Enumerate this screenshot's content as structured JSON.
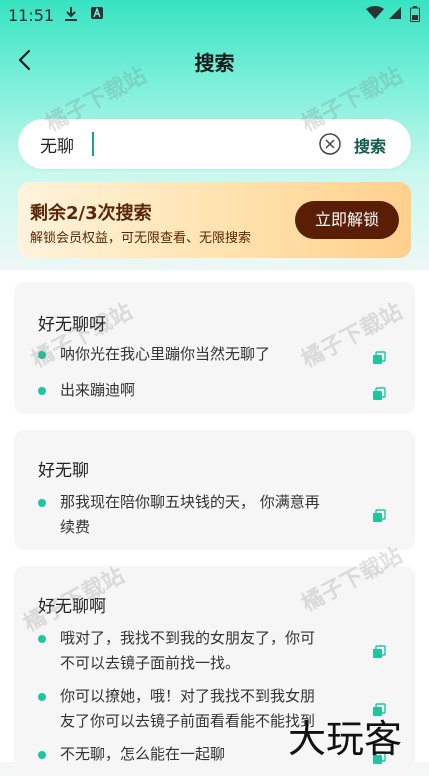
{
  "status_bar": {
    "time": "11:51",
    "download_icon": "download-icon",
    "app_icon": "app-badge-icon",
    "wifi_icon": "wifi-icon",
    "signal_icon": "signal-icon",
    "battery_icon": "battery-icon"
  },
  "nav": {
    "title": "搜索",
    "back_icon": "back-arrow-icon"
  },
  "search": {
    "value": "无聊",
    "button": "搜索",
    "clear_icon": "clear-circle-icon"
  },
  "banner": {
    "title": "剩余2/3次搜索",
    "subtitle": "解锁会员权益，可无限查看、无限搜索",
    "button": "立即解锁"
  },
  "results": [
    {
      "title": "好无聊呀",
      "lines": [
        "呐你光在我心里蹦你当然无聊了",
        "出来蹦迪啊"
      ]
    },
    {
      "title": "好无聊",
      "lines": [
        "那我现在陪你聊五块钱的天， 你满意再",
        "续费"
      ]
    },
    {
      "title": "好无聊啊",
      "lines": [
        "哦对了，我找不到我的女朋友了，你可",
        "不可以去镜子面前找一找。",
        "你可以撩她，哦！对了我找不到我女朋",
        "友了你可以去镜子前面看看能不能找到",
        "不无聊，怎么能在一起聊"
      ]
    }
  ],
  "watermarks": [
    "橘子下载站",
    "橘子下载站",
    "橘子下载站",
    "橘子下载站",
    "橘子下载站",
    "橘子下载站"
  ],
  "brand": "大玩客",
  "colors": {
    "accent": "#1fc59e",
    "banner_button": "#5a1e07",
    "banner_text": "#5a2608"
  }
}
